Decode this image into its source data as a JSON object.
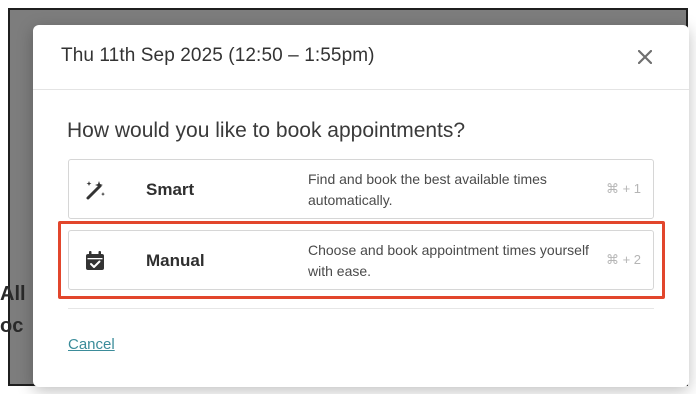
{
  "background": {
    "fragment_line_1": "All",
    "fragment_line_2": "oc"
  },
  "modal": {
    "title": "Thu 11th Sep 2025 (12:50 – 1:55pm)",
    "close_icon": "close-icon",
    "question": "How would you like to book appointments?",
    "options": [
      {
        "icon": "magic-wand-icon",
        "label": "Smart",
        "description": "Find and book the best available times automatically.",
        "shortcut": "⌘ + 1"
      },
      {
        "icon": "calendar-check-icon",
        "label": "Manual",
        "description": "Choose and book appointment times yourself with ease.",
        "shortcut": "⌘ + 2",
        "highlighted": true
      }
    ],
    "cancel_label": "Cancel"
  },
  "colors": {
    "highlight": "#e2462c",
    "link": "#3b8c9a",
    "backdrop": "#7d7d7d"
  }
}
